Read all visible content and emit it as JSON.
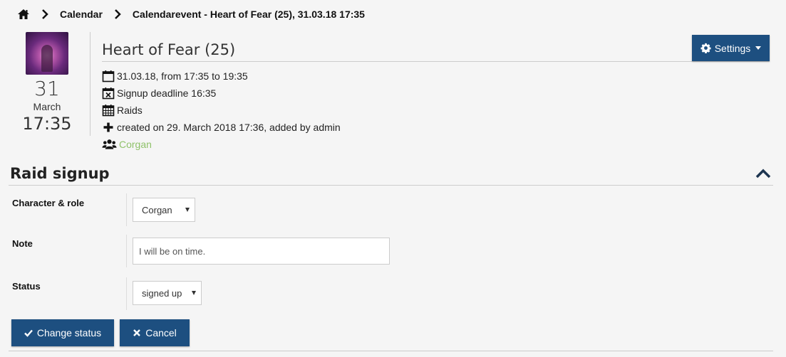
{
  "breadcrumb": {
    "home_icon": "home-icon",
    "items": [
      "Calendar",
      "Calendarevent - Heart of Fear (25), 31.03.18 17:35"
    ]
  },
  "event": {
    "day": "31",
    "month": "March",
    "time": "17:35",
    "title": "Heart of Fear (25)",
    "info": {
      "date_range": "31.03.18, from 17:35 to 19:35",
      "deadline": "Signup deadline 16:35",
      "category": "Raids",
      "created": "created on 29. March 2018 17:36, added by admin",
      "character": "Corgan"
    }
  },
  "settings_button": {
    "label": "Settings",
    "icon": "gear-icon"
  },
  "raid_signup": {
    "title": "Raid signup",
    "fields": {
      "character_label": "Character & role",
      "character_value": "Corgan",
      "note_label": "Note",
      "note_value": "I will be on time.",
      "status_label": "Status",
      "status_value": "signed up"
    },
    "buttons": {
      "change_status": "Change status",
      "cancel": "Cancel"
    }
  },
  "colors": {
    "primary": "#1d4f80",
    "link_green": "#8fc26a",
    "background": "#f5f5f5"
  }
}
